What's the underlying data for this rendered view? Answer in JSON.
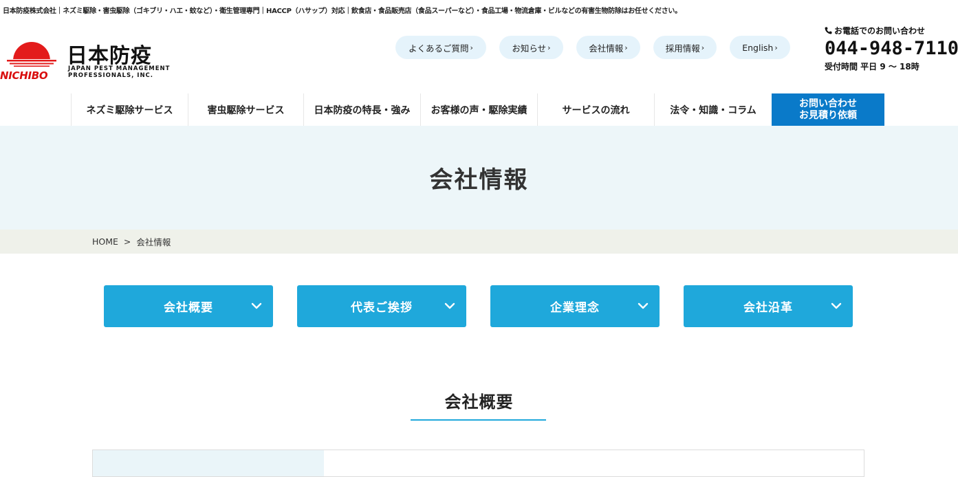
{
  "tagline": "日本防疫株式会社｜ネズミ駆除・害虫駆除（ゴキブリ・ハエ・蚊など）・衛生管理専門｜HACCP（ハサップ）対応｜飲食店・食品販売店（食品スーパーなど）・食品工場・物流倉庫・ビルなどの有害生物防除はお任せください。",
  "logo": {
    "jp": "日本防疫",
    "en_line1": "JAPAN PEST MANAGEMENT",
    "en_line2": "PROFESSIONALS, INC.",
    "roman": "NICHIBO",
    "sun_color": "#e31b1b"
  },
  "utility_nav": [
    {
      "label": "よくあるご質問"
    },
    {
      "label": "お知らせ"
    },
    {
      "label": "会社情報"
    },
    {
      "label": "採用情報"
    },
    {
      "label": "English"
    }
  ],
  "utility_arrow": "›",
  "phone": {
    "label": "お電話でのお問い合わせ",
    "number": "044-948-7110",
    "hours": "受付時間 平日 9 〜 18時"
  },
  "main_nav": [
    {
      "label": "ネズミ駆除サービス"
    },
    {
      "label": "害虫駆除サービス"
    },
    {
      "label": "日本防疫の特長・強み"
    },
    {
      "label": "お客様の声・駆除実績"
    },
    {
      "label": "サービスの流れ"
    },
    {
      "label": "法令・知識・コラム"
    }
  ],
  "cta": {
    "line1": "お問い合わせ",
    "line2": "お見積り依頼",
    "color": "#0a7ac9"
  },
  "hero": {
    "title": "会社情報"
  },
  "breadcrumb": {
    "home": "HOME",
    "separator": ">",
    "current": "会社情報"
  },
  "anchors": [
    {
      "label": "会社概要"
    },
    {
      "label": "代表ご挨拶"
    },
    {
      "label": "企業理念"
    },
    {
      "label": "会社沿革"
    }
  ],
  "accent_color": "#1fa8db",
  "section": {
    "title": "会社概要"
  }
}
